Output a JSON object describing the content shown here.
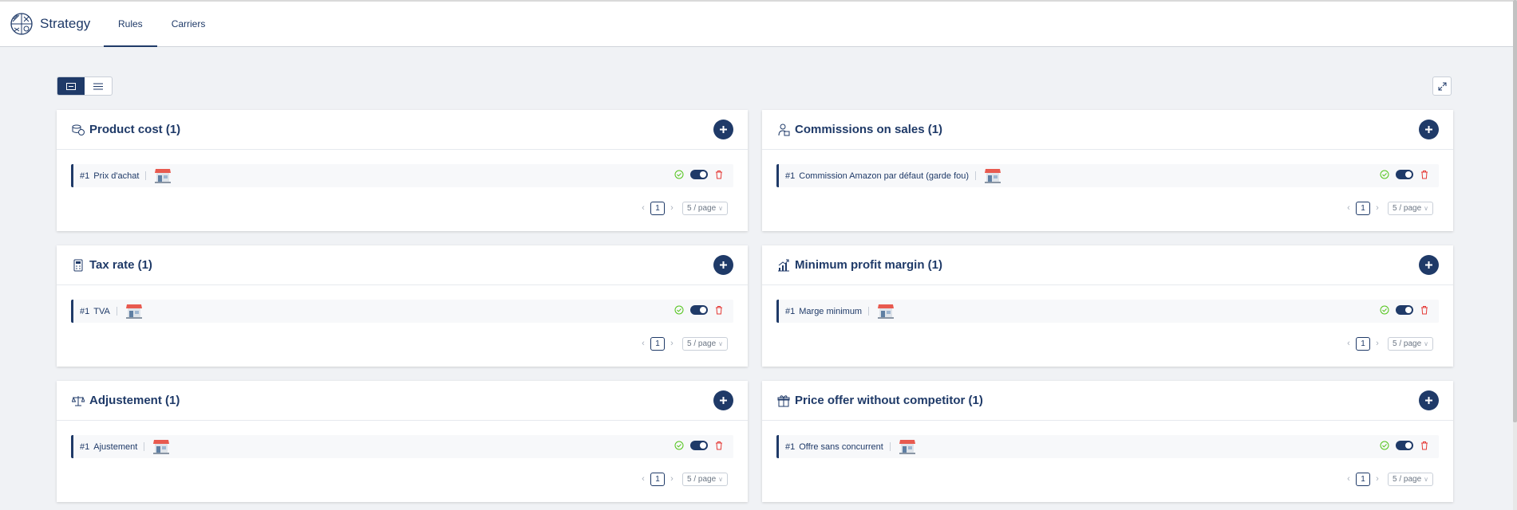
{
  "app": {
    "title": "Strategy"
  },
  "nav": {
    "tabs": [
      {
        "label": "Rules",
        "active": true
      },
      {
        "label": "Carriers",
        "active": false
      }
    ]
  },
  "colors": {
    "primary": "#1f3a68",
    "success": "#52c41a",
    "danger": "#e53935",
    "background": "#f0f2f5"
  },
  "cards": [
    {
      "title": "Product cost (1)",
      "icon": "coins-icon",
      "rule": {
        "num": "#1",
        "name": "Prix d'achat",
        "active": true
      }
    },
    {
      "title": "Commissions on sales (1)",
      "icon": "person-money-icon",
      "rule": {
        "num": "#1",
        "name": "Commission Amazon par défaut (garde fou)",
        "active": true
      }
    },
    {
      "title": "Tax rate (1)",
      "icon": "calculator-icon",
      "rule": {
        "num": "#1",
        "name": "TVA",
        "active": true
      }
    },
    {
      "title": "Minimum profit margin (1)",
      "icon": "growth-chart-icon",
      "rule": {
        "num": "#1",
        "name": "Marge minimum",
        "active": true
      }
    },
    {
      "title": "Adjustement (1)",
      "icon": "scale-icon",
      "rule": {
        "num": "#1",
        "name": "Ajustement",
        "active": true
      }
    },
    {
      "title": "Price offer without competitor (1)",
      "icon": "gift-icon",
      "rule": {
        "num": "#1",
        "name": "Offre sans concurrent",
        "active": true
      }
    }
  ],
  "pagination": {
    "page": "1",
    "page_size": "5 / page",
    "prev": "‹",
    "next": "›"
  }
}
